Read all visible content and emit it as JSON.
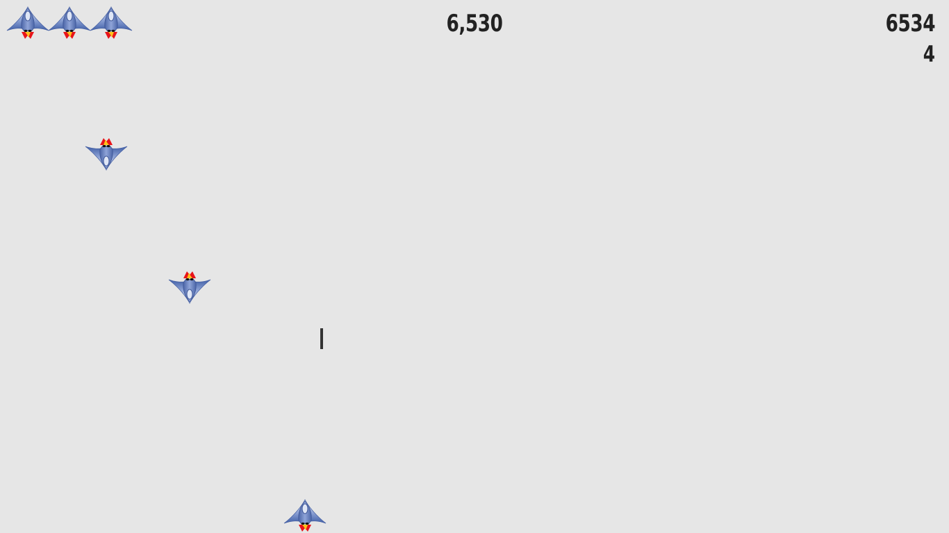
{
  "hud": {
    "score": "6,530",
    "high_score": "6534",
    "level": "4"
  },
  "lives": {
    "count": 3,
    "icon": "player-ship-icon"
  },
  "entities": {
    "player_ship_icon": "player-ship-icon",
    "enemy_ship_icon": "enemy-ship-icon",
    "enemy_count": 2,
    "bullet_count": 1
  },
  "colors": {
    "background": "#e6e6e6",
    "text": "#222222",
    "ship_body": "#5b78b8",
    "ship_highlight": "#c9d3ee",
    "flame_outer": "#e8141a",
    "flame_inner": "#ffc21a",
    "bullet": "#333333"
  }
}
